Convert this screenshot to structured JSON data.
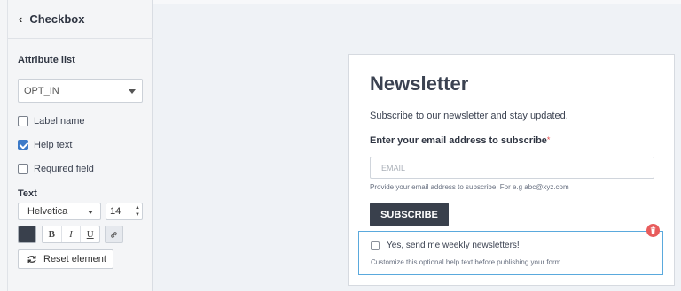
{
  "sidebar": {
    "header_title": "Checkbox",
    "attribute_list_label": "Attribute list",
    "attribute_value": "OPT_IN",
    "options": [
      {
        "label": "Label name",
        "checked": false
      },
      {
        "label": "Help text",
        "checked": true
      },
      {
        "label": "Required field",
        "checked": false
      }
    ],
    "text_section_label": "Text",
    "font_family": "Helvetica",
    "font_size": "14",
    "text_color": "#39404c",
    "format_buttons": [
      "B",
      "I",
      "U"
    ],
    "reset_label": "Reset element"
  },
  "form": {
    "title": "Newsletter",
    "subtitle": "Subscribe to our newsletter and stay updated.",
    "email_label": "Enter your email address to subscribe",
    "required_marker": "*",
    "email_placeholder": "EMAIL",
    "email_help": "Provide your email address to subscribe. For e.g abc@xyz.com",
    "subscribe_label": "SUBSCRIBE",
    "optin_label": "Yes, send me weekly newsletters!",
    "optin_help": "Customize this optional help text before publishing your form."
  },
  "colors": {
    "selection_outline": "#5aa9dd",
    "delete": "#e85c5c",
    "button_dark": "#39404c",
    "checkbox_checked": "#3c7ac8"
  }
}
